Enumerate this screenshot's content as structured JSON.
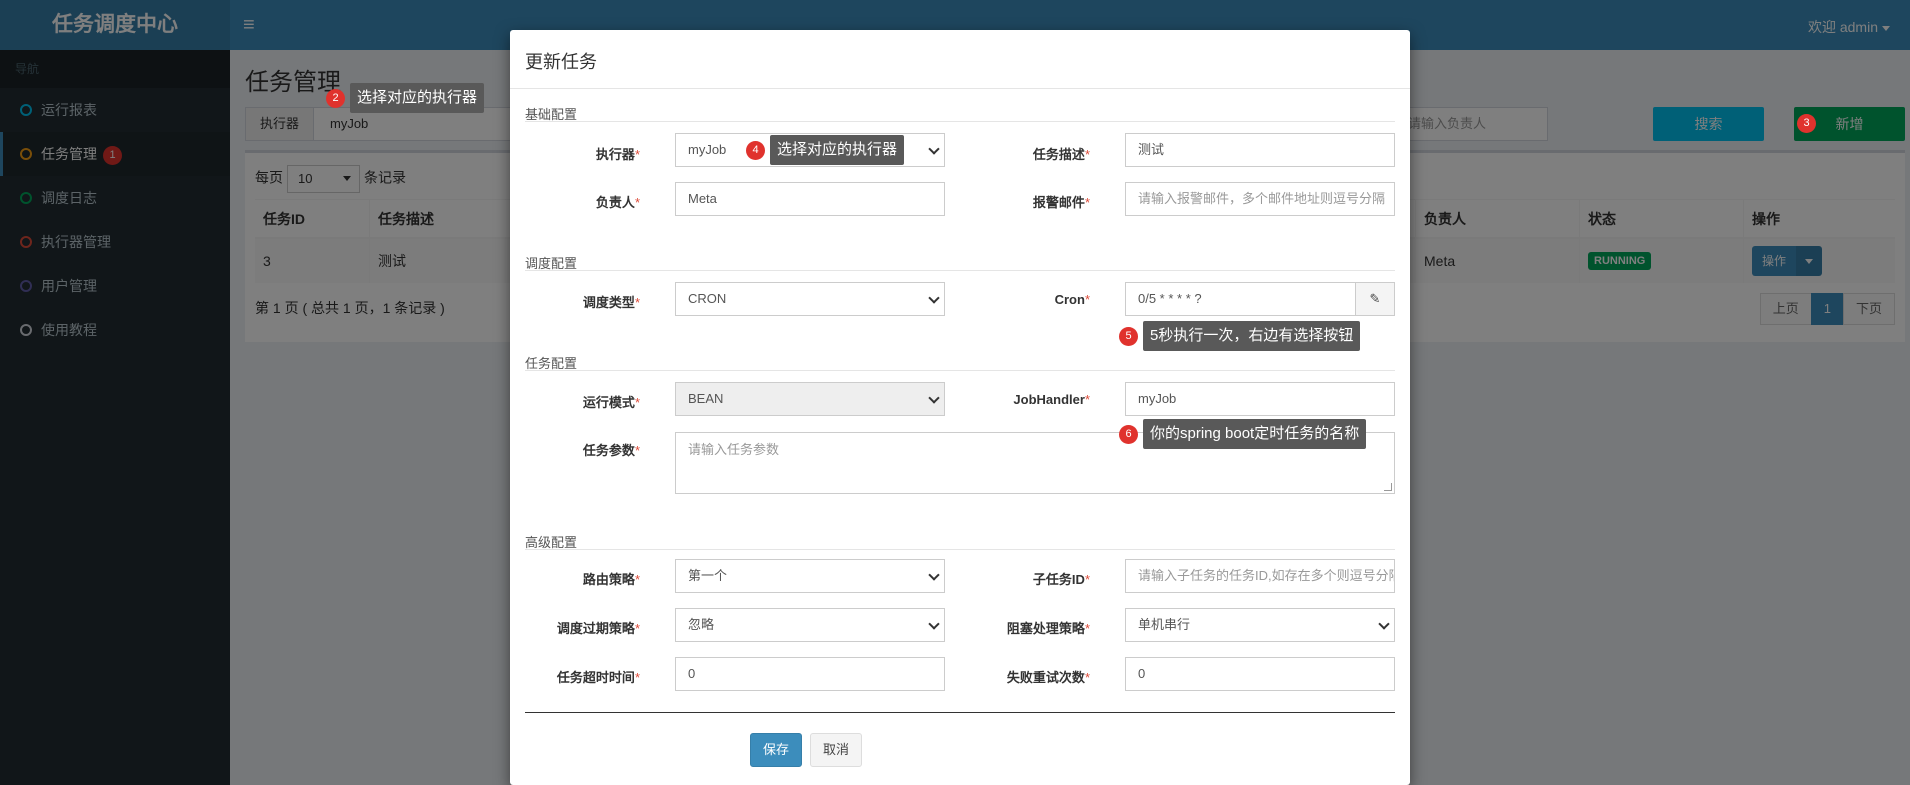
{
  "header": {
    "app_title": "任务调度中心",
    "menu_icon": "hamburger-icon",
    "welcome": "欢迎 admin"
  },
  "sidebar": {
    "nav_header": "导航",
    "items": [
      {
        "label": "运行报表",
        "color": "#00c0ef"
      },
      {
        "label": "任务管理",
        "color": "#f39c12",
        "badge": "1"
      },
      {
        "label": "调度日志",
        "color": "#00a65a"
      },
      {
        "label": "执行器管理",
        "color": "#dd4b39"
      },
      {
        "label": "用户管理",
        "color": "#605ca8"
      },
      {
        "label": "使用教程",
        "color": "#d2d6de"
      }
    ]
  },
  "page": {
    "title": "任务管理",
    "filter_addon": "执行器",
    "filter_value": "myJob",
    "owner_placeholder": "请输入负责人",
    "search_button": "搜索",
    "add_button": "新增",
    "per_page_prefix": "每页",
    "per_page_value": "10",
    "per_page_suffix": "条记录",
    "table": {
      "headers": [
        "任务ID",
        "任务描述",
        "负责人",
        "状态",
        "操作"
      ],
      "row": {
        "id": "3",
        "desc": "测试",
        "owner": "Meta",
        "status": "RUNNING",
        "op": "操作"
      }
    },
    "page_info": "第 1 页 ( 总共 1 页，1 条记录 )",
    "pager": {
      "prev": "上页",
      "current": "1",
      "next": "下页"
    }
  },
  "modal": {
    "title": "更新任务",
    "sections": {
      "basic": "基础配置",
      "schedule": "调度配置",
      "task": "任务配置",
      "advanced": "高级配置"
    },
    "fields": {
      "executor": {
        "label": "执行器",
        "value": "myJob"
      },
      "job_desc": {
        "label": "任务描述",
        "value": "测试"
      },
      "author": {
        "label": "负责人",
        "value": "Meta"
      },
      "alarm_email": {
        "label": "报警邮件",
        "placeholder": "请输入报警邮件，多个邮件地址则逗号分隔"
      },
      "schedule_type": {
        "label": "调度类型",
        "value": "CRON"
      },
      "cron": {
        "label": "Cron",
        "value": "0/5 * * * * ?",
        "icon": "edit-icon"
      },
      "run_mode": {
        "label": "运行模式",
        "value": "BEAN"
      },
      "job_handler": {
        "label": "JobHandler",
        "value": "myJob"
      },
      "job_param": {
        "label": "任务参数",
        "placeholder": "请输入任务参数"
      },
      "route_strategy": {
        "label": "路由策略",
        "value": "第一个"
      },
      "child_job": {
        "label": "子任务ID",
        "placeholder": "请输入子任务的任务ID,如存在多个则逗号分隔"
      },
      "misfire_strategy": {
        "label": "调度过期策略",
        "value": "忽略"
      },
      "block_strategy": {
        "label": "阻塞处理策略",
        "value": "单机串行"
      },
      "timeout": {
        "label": "任务超时时间",
        "value": "0"
      },
      "fail_retry": {
        "label": "失败重试次数",
        "value": "0"
      }
    },
    "save_button": "保存",
    "cancel_button": "取消"
  },
  "annotations": [
    {
      "num": "2",
      "text": "选择对应的执行器"
    },
    {
      "num": "3",
      "text": ""
    },
    {
      "num": "4",
      "text": "选择对应的执行器"
    },
    {
      "num": "5",
      "text": "5秒执行一次，右边有选择按钮"
    },
    {
      "num": "6",
      "text": "你的spring boot定时任务的名称"
    }
  ]
}
